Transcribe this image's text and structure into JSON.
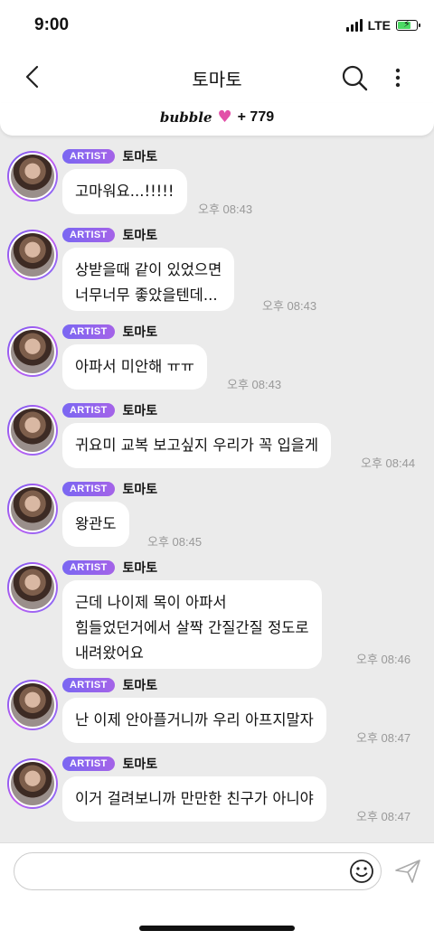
{
  "status_bar": {
    "time": "9:00",
    "network": "LTE"
  },
  "header": {
    "title": "토마토"
  },
  "bubble_bar": {
    "logo": "bubble",
    "count": "+ 779"
  },
  "messages": [
    {
      "badge": "ARTIST",
      "sender": "토마토",
      "text": "고마워요...!!!!!",
      "time": "오후 08:43"
    },
    {
      "badge": "ARTIST",
      "sender": "토마토",
      "text": "상받을때 같이 있었으면\n너무너무 좋았을텐데...",
      "time": "오후 08:43"
    },
    {
      "badge": "ARTIST",
      "sender": "토마토",
      "text": "아파서 미안해 ㅠㅠ",
      "time": "오후 08:43"
    },
    {
      "badge": "ARTIST",
      "sender": "토마토",
      "text": "귀요미 교복 보고싶지 우리가 꼭 입을게",
      "time": "오후 08:44"
    },
    {
      "badge": "ARTIST",
      "sender": "토마토",
      "text": "왕관도",
      "time": "오후 08:45"
    },
    {
      "badge": "ARTIST",
      "sender": "토마토",
      "text": "근데 나이제 목이 아파서\n힘들었던거에서 살짝 간질간질 정도로\n내려왔어요",
      "time": "오후 08:46"
    },
    {
      "badge": "ARTIST",
      "sender": "토마토",
      "text": "난 이제 안아플거니까 우리 아프지말자",
      "time": "오후 08:47"
    },
    {
      "badge": "ARTIST",
      "sender": "토마토",
      "text": "이거 걸려보니까 만만한 친구가 아니야",
      "time": "오후 08:47"
    }
  ],
  "composer": {
    "placeholder": ""
  },
  "colors": {
    "accent": "#7a67f2",
    "heart": "#e24fa8",
    "background": "#ebebeb"
  },
  "icons": [
    "back-icon",
    "search-icon",
    "more-icon",
    "emoji-icon",
    "send-icon"
  ]
}
